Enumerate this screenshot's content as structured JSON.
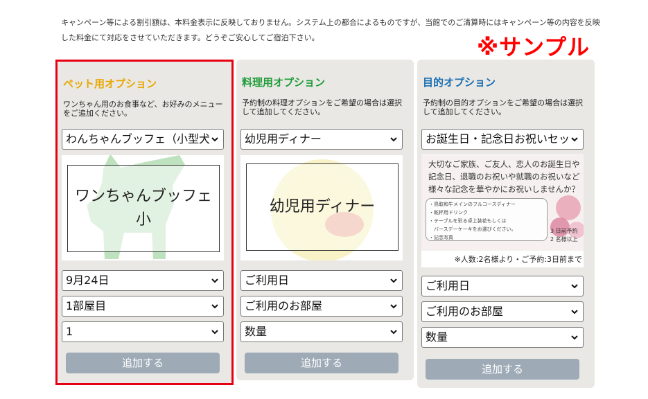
{
  "notice": "キャンペーン等による割引額は、本料金表示に反映しておりません。システム上の都合によるものですが、当館でのご清算時にはキャンペーン等の内容を反映した料金にて対応をさせていただきます。どうぞご安心してご宿泊下さい。",
  "sample_label": "※サンプル",
  "colors": {
    "pet_title": "#e8a700",
    "food_title": "#1f9d3a",
    "purpose_title": "#1a6fb3",
    "highlight_border": "#e60012",
    "button_bg": "#9eabb7"
  },
  "pet": {
    "title": "ペット用オプション",
    "desc": "ワンちゃん用のお食事など、お好みのメニューをご追加ください。",
    "menu_select": "わんちゃんブッフェ（小型犬",
    "image_text_1": "ワンちゃんブッフェ",
    "image_text_2": "小",
    "date_select": "9月24日",
    "room_select": "1部屋目",
    "qty_select": "1",
    "add_button": "追加する"
  },
  "food": {
    "title": "料理用オプション",
    "desc": "予約制の料理オプションをご希望の場合は選択して追加してください。",
    "menu_select": "幼児用ディナー",
    "image_text": "幼児用ディナー",
    "date_select": "ご利用日",
    "room_select": "ご利用のお部屋",
    "qty_select": "数量",
    "add_button": "追加する"
  },
  "purpose": {
    "title": "目的オプション",
    "desc": "予約制の目的オプションをご希望の場合は選択して追加してください。",
    "menu_select": "お誕生日・記念日お祝いセッ",
    "promo_text": "大切なご家族、ご友人、恋人のお誕生日や記念日、退職のお祝いや就職のお祝いなど様々な記念を華やかにお祝いしませんか？",
    "promo_items": [
      "・鳥取和牛メインのフルコースディナー",
      "・乾杯用ドリンク",
      "・テーブルを彩る卓上装花もしくは",
      "　バースデーケーキをお選びください。",
      "・記念写真"
    ],
    "promo_side_1": "3 日前予約",
    "promo_side_2": "2 名様以上",
    "promo_foot": "※人数:2名様より・ご予約:3日前まで",
    "date_select": "ご利用日",
    "room_select": "ご利用のお部屋",
    "qty_select": "数量",
    "add_button": "追加する"
  }
}
